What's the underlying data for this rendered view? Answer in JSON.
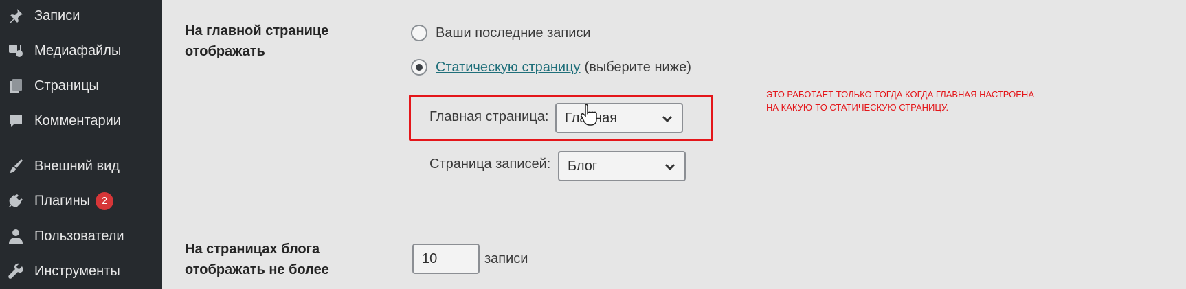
{
  "sidebar": {
    "items": [
      {
        "label": "Записи",
        "icon": "pushpin-icon"
      },
      {
        "label": "Медиафайлы",
        "icon": "media-icon"
      },
      {
        "label": "Страницы",
        "icon": "pages-icon"
      },
      {
        "label": "Комментарии",
        "icon": "comment-icon"
      },
      {
        "label": "Внешний вид",
        "icon": "paintbrush-icon"
      },
      {
        "label": "Плагины",
        "icon": "plugin-icon",
        "badge": "2"
      },
      {
        "label": "Пользователи",
        "icon": "user-icon"
      },
      {
        "label": "Инструменты",
        "icon": "wrench-icon"
      }
    ],
    "colors": {
      "background": "#262a2e",
      "badge": "#d63638"
    }
  },
  "homepage_setting": {
    "label_line1": "На главной странице",
    "label_line2": "отображать",
    "option_latest": "Ваши последние записи",
    "option_static_link": "Статическую страницу",
    "option_static_hint": "(выберите ниже)",
    "selected": "static"
  },
  "front_page": {
    "label": "Главная страница:",
    "value": "Главная"
  },
  "posts_page": {
    "label": "Страница записей:",
    "value": "Блог"
  },
  "blog_pages": {
    "label_line1": "На страницах блога",
    "label_line2": "отображать не более",
    "value": "10",
    "unit": "записи"
  },
  "annotation": {
    "line1": "ЭТО РАБОТАЕТ ТОЛЬКО ТОГДА КОГДА ГЛАВНАЯ НАСТРОЕНА",
    "line2": "НА КАКУЮ-ТО СТАТИЧЕСКУЮ СТРАНИЦУ.",
    "color": "#e4161a"
  }
}
